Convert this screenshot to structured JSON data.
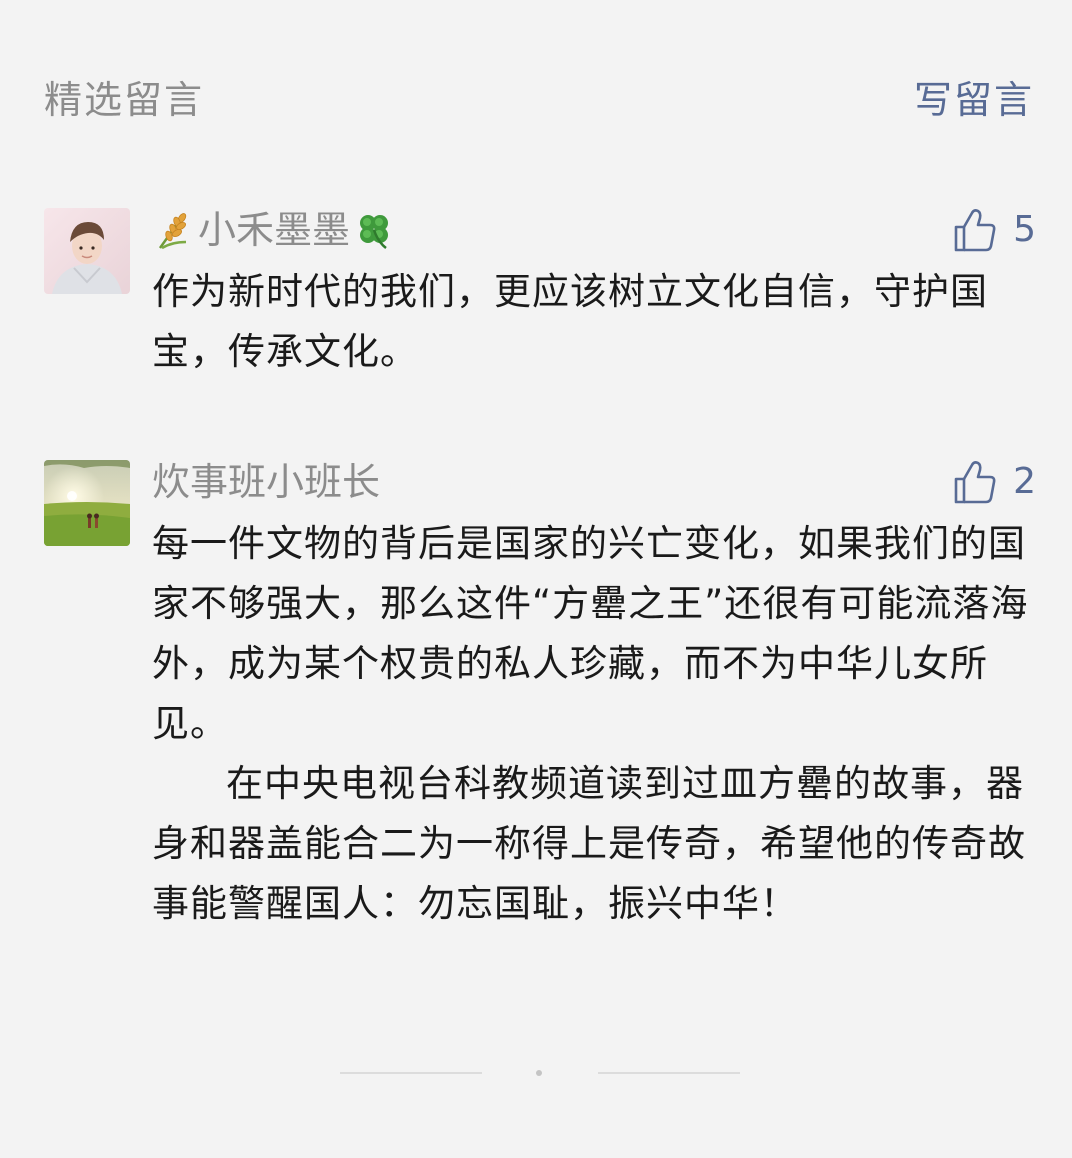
{
  "header": {
    "title": "精选留言",
    "write_label": "写留言"
  },
  "colors": {
    "background": "#f3f3f3",
    "muted_text": "#8c8c8c",
    "accent": "#586b95",
    "body_text": "#1a1a1a"
  },
  "comments": [
    {
      "nickname": "小禾墨墨",
      "nickname_prefix_icon": "rice-ear-icon",
      "nickname_suffix_icon": "four-leaf-clover-icon",
      "likes": "5",
      "paragraphs": [
        "作为新时代的我们，更应该树立文化自信，守护国宝，传承文化。"
      ]
    },
    {
      "nickname": "炊事班小班长",
      "likes": "2",
      "paragraphs": [
        "每一件文物的背后是国家的兴亡变化，如果我们的国家不够强大，那么这件“方罍之王”还很有可能流落海外，成为某个权贵的私人珍藏，而不为中华儿女所见。",
        "在中央电视台科教频道读到过皿方罍的故事，器身和器盖能合二为一称得上是传奇，希望他的传奇故事能警醒国人：勿忘国耻，振兴中华！"
      ]
    }
  ]
}
